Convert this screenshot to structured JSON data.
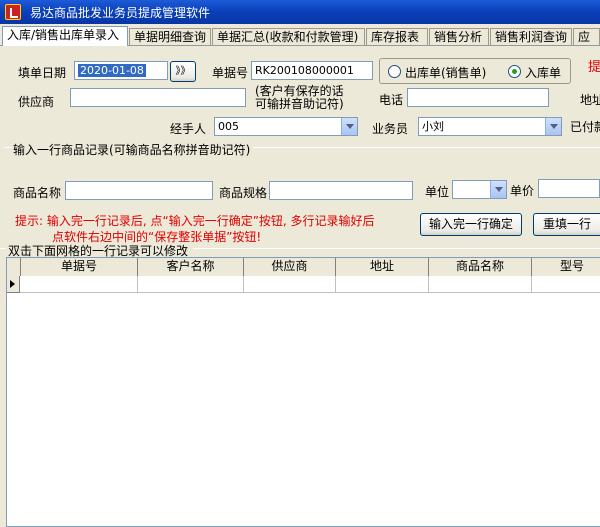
{
  "app": {
    "title": "易达商品批发业务员提成管理软件"
  },
  "tabs": [
    {
      "label": "入库/销售出库单录入"
    },
    {
      "label": "单据明细查询"
    },
    {
      "label": "单据汇总(收款和付款管理)"
    },
    {
      "label": "库存报表"
    },
    {
      "label": "销售分析"
    },
    {
      "label": "销售利润查询"
    },
    {
      "label": "应收"
    }
  ],
  "form": {
    "date_label": "填单日期",
    "date_value": "2020-01-08",
    "date_button": "》》",
    "order_no_label": "单据号",
    "order_no_value": "RK200108000001",
    "radio_out_label": "出库单(销售单)",
    "radio_in_label": "入库单",
    "radio_selected": "入库单",
    "hint_right": "提",
    "supplier_label": "供应商",
    "supplier_value": "",
    "supplier_note": "(客户有保存的话\n可输拼音助记符)",
    "phone_label": "电话",
    "phone_value": "",
    "address_label": "地址",
    "handler_label": "经手人",
    "handler_value": "005",
    "salesman_label": "业务员",
    "salesman_value": "小刘",
    "paid_label": "已付款"
  },
  "entry": {
    "group_title": "输入一行商品记录(可输商品名称拼音助记符)",
    "product_name_label": "商品名称",
    "product_name_value": "",
    "product_spec_label": "商品规格",
    "product_spec_value": "",
    "unit_label": "单位",
    "unit_value": "",
    "price_label": "单价",
    "price_value": "",
    "hint_line1": "提示: 输入完一行记录后, 点“输入完一行确定”按钮, 多行记录输好后",
    "hint_line2": "点软件右边中间的“保存整张单据”按钮!",
    "confirm_button": "输入完一行确定",
    "reset_button": "重填一行"
  },
  "grid": {
    "caption": "双击下面网格的一行记录可以修改",
    "columns": [
      "单据号",
      "客户名称",
      "供应商",
      "地址",
      "商品名称",
      "型号"
    ]
  },
  "colors": {
    "title_bar": "#0a3fb8",
    "hint_red": "#e00000",
    "selection": "#316ac5"
  }
}
